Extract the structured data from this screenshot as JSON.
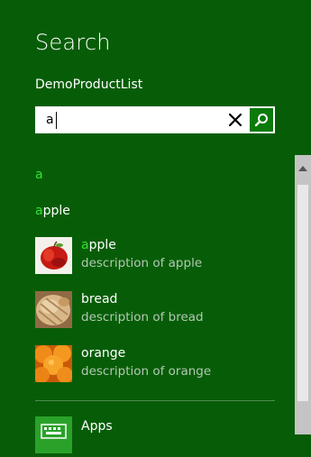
{
  "pane": {
    "title": "Search",
    "app_name": "DemoProductList"
  },
  "search": {
    "value": "a",
    "clear_icon": "close-icon",
    "go_icon": "search-icon"
  },
  "query_suggestions": [
    {
      "match": "a",
      "rest": ""
    },
    {
      "match": "a",
      "rest": "pple"
    }
  ],
  "results": [
    {
      "match": "a",
      "rest": "pple",
      "title": "apple",
      "description": "description of apple",
      "thumb": "apple"
    },
    {
      "match": "",
      "rest": "bread",
      "title": "bread",
      "description": "description of bread",
      "thumb": "bread"
    },
    {
      "match": "",
      "rest": "orange",
      "title": "orange",
      "description": "description of orange",
      "thumb": "orange"
    }
  ],
  "apps": {
    "label": "Apps",
    "icon": "keyboard-icon"
  },
  "colors": {
    "background": "#075d07",
    "highlight": "#34e034",
    "go_button": "#0a7a0a",
    "apps_tile": "#2aa22a"
  }
}
